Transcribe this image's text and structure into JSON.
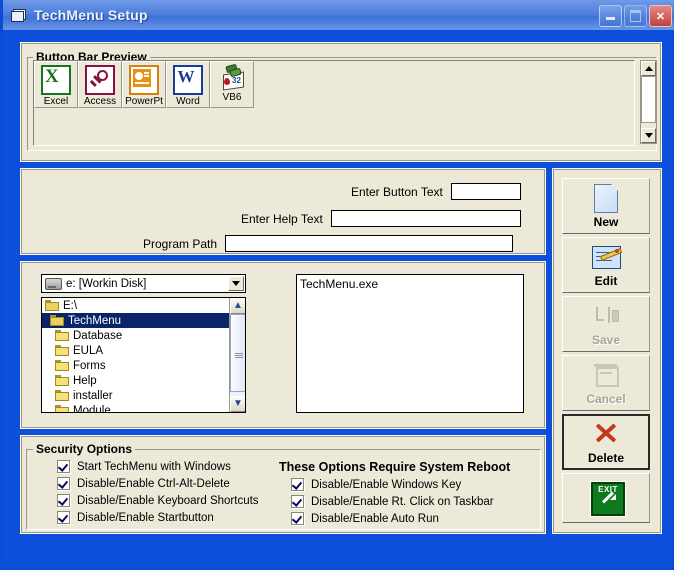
{
  "window": {
    "title": "TechMenu Setup",
    "icon": "window-document-icon",
    "buttons": {
      "minimize": "minimize",
      "maximize": "maximize",
      "close": "close"
    },
    "colors": {
      "frame_blue": "#0b4fdb",
      "face": "#ece9d8",
      "title_blue": "#4f7fdd",
      "selection": "#0a246a"
    }
  },
  "preview": {
    "group_title": "Button Bar Preview",
    "buttons": [
      {
        "label": "Excel",
        "icon": "excel-icon"
      },
      {
        "label": "Access",
        "icon": "access-icon"
      },
      {
        "label": "PowerPt",
        "icon": "powerpoint-icon"
      },
      {
        "label": "Word",
        "icon": "word-icon"
      },
      {
        "label": "VB6",
        "icon": "vb6-icon"
      }
    ],
    "scrollbar": {
      "up": "scroll-up-icon",
      "down": "scroll-down-icon"
    }
  },
  "fields": {
    "button_text": {
      "label": "Enter Button Text",
      "value": "",
      "placeholder": ""
    },
    "help_text": {
      "label": "Enter Help Text",
      "value": "",
      "placeholder": ""
    },
    "program_path": {
      "label": "Program Path",
      "value": "",
      "placeholder": ""
    }
  },
  "browser": {
    "drive": {
      "selected": "e: [Workin Disk]",
      "icon": "drive-icon",
      "arrow": "chevron-down-icon"
    },
    "directories": [
      {
        "name": "E:\\",
        "selected": false,
        "open": true,
        "indent": 0
      },
      {
        "name": "TechMenu",
        "selected": true,
        "open": true,
        "indent": 1
      },
      {
        "name": "Database",
        "selected": false,
        "open": false,
        "indent": 2
      },
      {
        "name": "EULA",
        "selected": false,
        "open": false,
        "indent": 2
      },
      {
        "name": "Forms",
        "selected": false,
        "open": false,
        "indent": 2
      },
      {
        "name": "Help",
        "selected": false,
        "open": false,
        "indent": 2
      },
      {
        "name": "installer",
        "selected": false,
        "open": false,
        "indent": 2
      },
      {
        "name": "Module",
        "selected": false,
        "open": false,
        "indent": 2
      }
    ],
    "files": [
      "TechMenu.exe"
    ]
  },
  "security": {
    "group_title": "Security Options",
    "reboot_heading": "These Options Require System Reboot",
    "left_options": [
      {
        "label": "Start TechMenu with Windows",
        "checked": true
      },
      {
        "label": "Disable/Enable Ctrl-Alt-Delete",
        "checked": true
      },
      {
        "label": "Disable/Enable Keyboard Shortcuts",
        "checked": true
      },
      {
        "label": "Disable/Enable Startbutton",
        "checked": true
      }
    ],
    "right_options": [
      {
        "label": "Disable/Enable Windows Key",
        "checked": true
      },
      {
        "label": "Disable/Enable Rt. Click on Taskbar",
        "checked": true
      },
      {
        "label": "Disable/Enable Auto Run",
        "checked": true
      }
    ]
  },
  "actions": [
    {
      "label": "New",
      "icon": "new-document-icon",
      "enabled": true,
      "focused": false
    },
    {
      "label": "Edit",
      "icon": "edit-pencil-icon",
      "enabled": true,
      "focused": false
    },
    {
      "label": "Save",
      "icon": "save-icon",
      "enabled": false,
      "focused": false
    },
    {
      "label": "Cancel",
      "icon": "cancel-undo-icon",
      "enabled": false,
      "focused": false
    },
    {
      "label": "Delete",
      "icon": "delete-x-icon",
      "enabled": true,
      "focused": true
    },
    {
      "label": "",
      "icon": "exit-door-icon",
      "enabled": true,
      "focused": false
    }
  ]
}
